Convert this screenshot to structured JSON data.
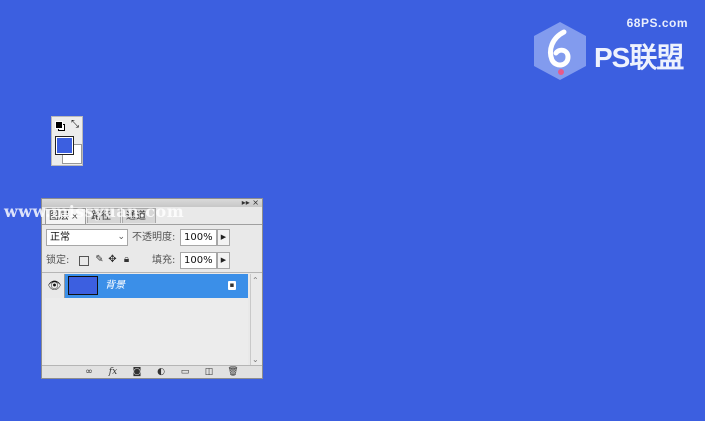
{
  "logo": {
    "site": "68PS.com",
    "text": "PS联盟"
  },
  "watermark": "www.missyuan.com",
  "toolbox": {
    "foreground_color": "#3c5fe0",
    "background_color": "#ffffff"
  },
  "layers_panel": {
    "tabs": [
      {
        "label": "图层",
        "close": "×",
        "active": true
      },
      {
        "label": "路径",
        "active": false
      },
      {
        "label": "通道",
        "active": false
      }
    ],
    "window_buttons": "▸▸ ×",
    "blend_mode": "正常",
    "opacity_label": "不透明度:",
    "opacity_value": "100%",
    "lock_label": "锁定:",
    "fill_label": "填充:",
    "fill_value": "100%",
    "layers": [
      {
        "name": "背景",
        "visible": true,
        "locked": true,
        "selected": true,
        "thumb_color": "#3c5fe0"
      }
    ]
  }
}
